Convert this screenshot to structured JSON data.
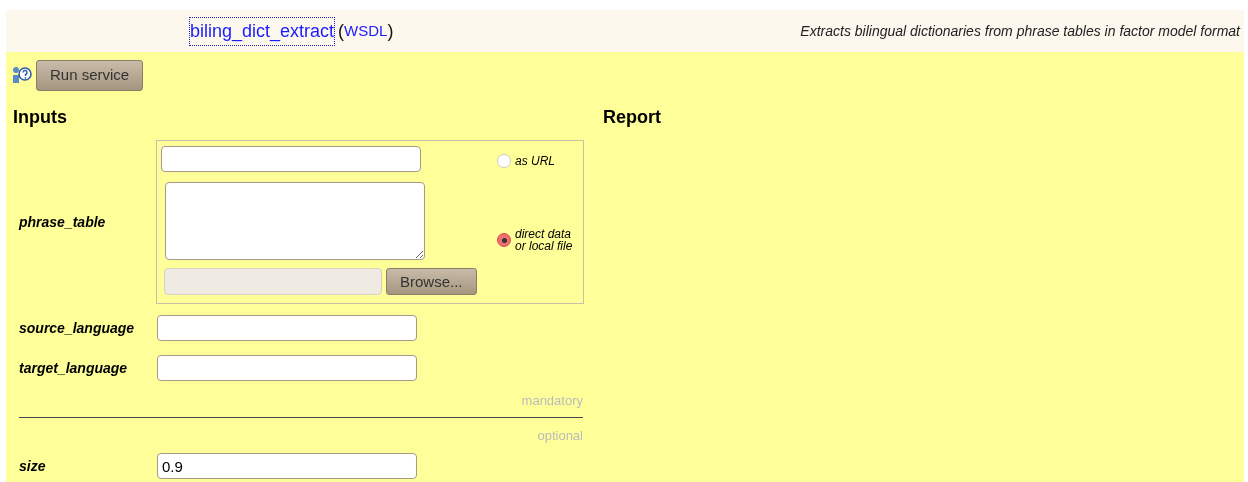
{
  "header": {
    "service_link": "biling_dict_extract",
    "wsdl_open": "(",
    "wsdl_link": "WSDL",
    "wsdl_close": ")",
    "description": "Extracts bilingual dictionaries from phrase tables in factor model format"
  },
  "run_button": "Run service",
  "inputs_heading": "Inputs",
  "report_heading": "Report",
  "phrase_table": {
    "label": "phrase_table",
    "options": [
      {
        "kind": "url",
        "label": "as URL",
        "selected": false
      },
      {
        "kind": "data",
        "label": "direct data or local file",
        "selected": true
      }
    ],
    "browse_button": "Browse..."
  },
  "mandatory_fields": [
    {
      "label": "source_language"
    },
    {
      "label": "target_language"
    }
  ],
  "mandatory_note": "mandatory",
  "optional_note": "optional",
  "optional_fields": [
    {
      "label": "size",
      "value": "0.9"
    }
  ]
}
